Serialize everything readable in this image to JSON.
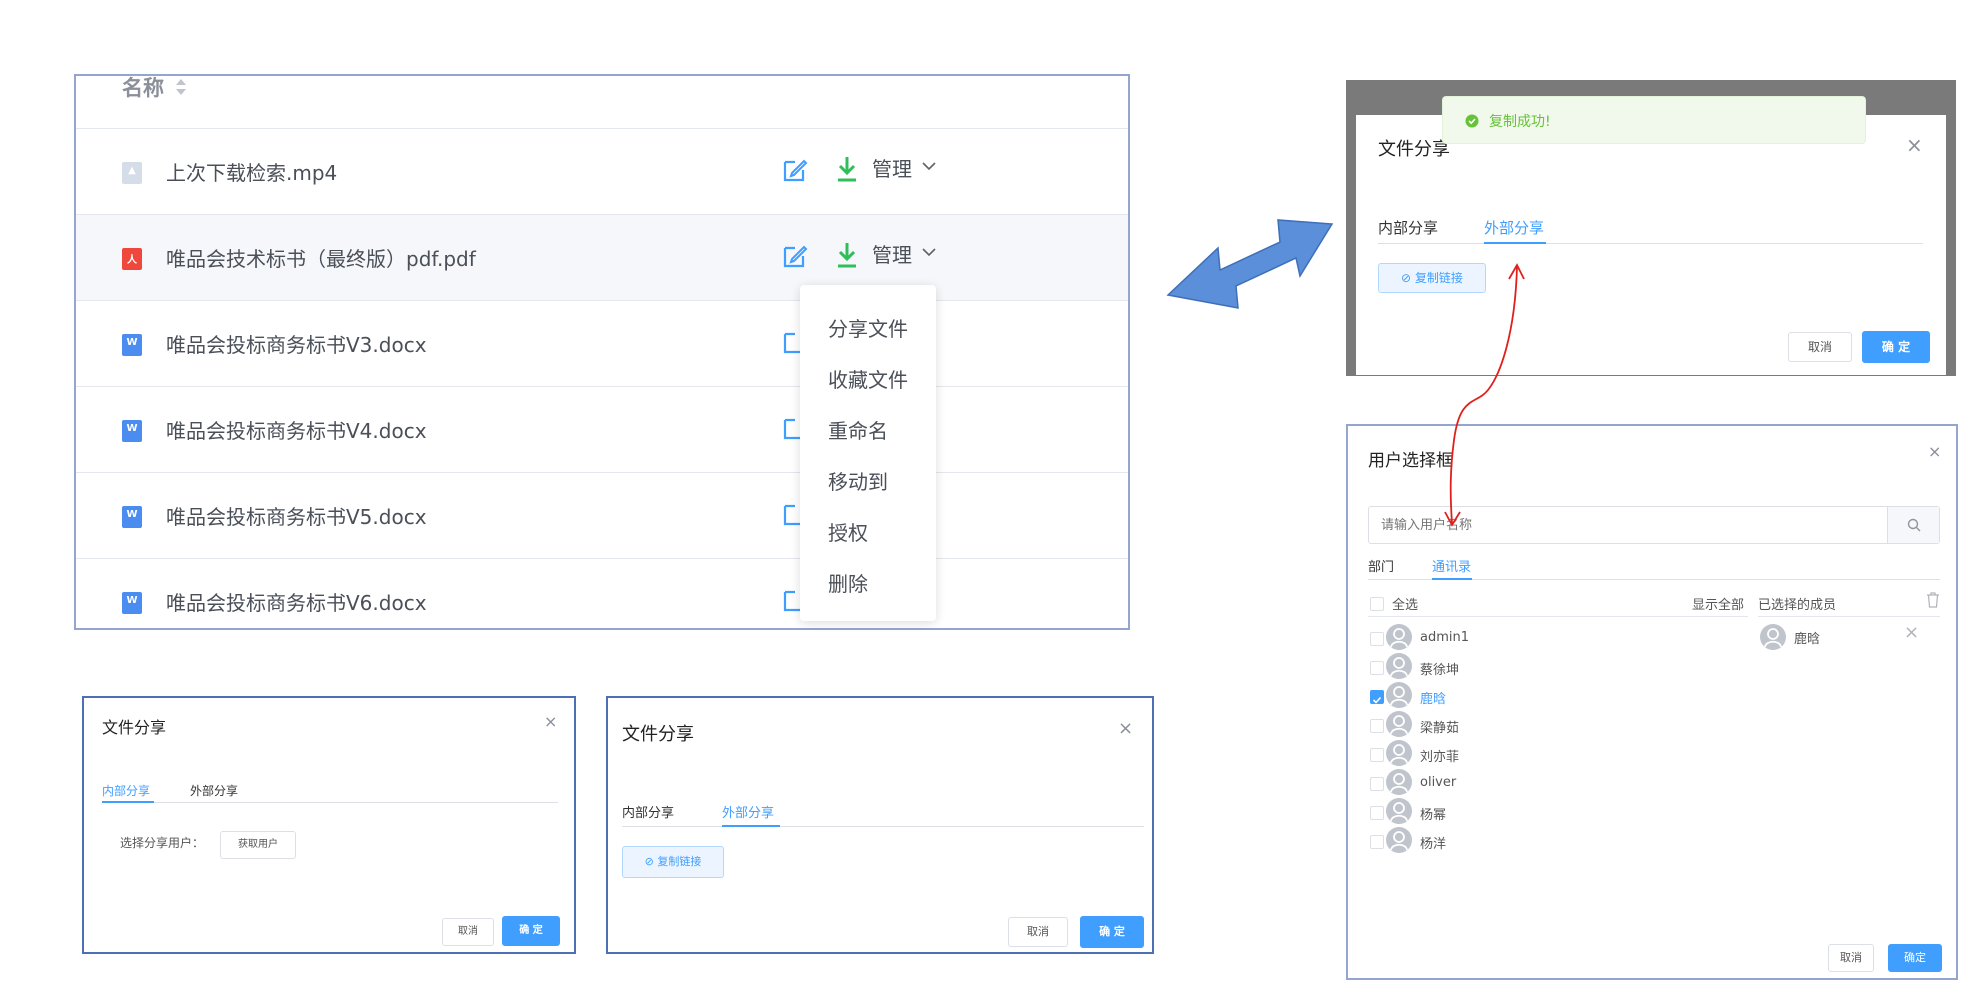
{
  "file_list": {
    "column_header": "名称",
    "rows": [
      {
        "name": "上次下载检索.mp4",
        "type": "video"
      },
      {
        "name": "唯品会技术标书（最终版）pdf.pdf",
        "type": "pdf"
      },
      {
        "name": "唯品会投标商务标书V3.docx",
        "type": "word"
      },
      {
        "name": "唯品会投标商务标书V4.docx",
        "type": "word"
      },
      {
        "name": "唯品会投标商务标书V5.docx",
        "type": "word"
      },
      {
        "name": "唯品会投标商务标书V6.docx",
        "type": "word"
      }
    ],
    "manage_label": "管理",
    "word_icon_letter": "W",
    "pdf_icon_letter": "人"
  },
  "dropdown_menu": [
    "分享文件",
    "收藏文件",
    "重命名",
    "移动到",
    "授权",
    "删除"
  ],
  "share_dialog": {
    "title": "文件分享",
    "tab_internal": "内部分享",
    "tab_external": "外部分享",
    "copy_link": "复制链接",
    "select_user_label": "选择分享用户：",
    "get_user": "获取用户",
    "cancel": "取消",
    "confirm": "确 定",
    "close": "×"
  },
  "toast": {
    "message": "复制成功!",
    "color": "#67c23a"
  },
  "user_dialog": {
    "title": "用户选择框",
    "search_placeholder": "请输入用户名称",
    "tab_department": "部门",
    "tab_contacts": "通讯录",
    "select_all": "全选",
    "show_all": "显示全部",
    "selected_members": "已选择的成员",
    "users": [
      {
        "name": "admin1",
        "checked": false
      },
      {
        "name": "蔡徐坤",
        "checked": false
      },
      {
        "name": "鹿晗",
        "checked": true
      },
      {
        "name": "梁静茹",
        "checked": false
      },
      {
        "name": "刘亦菲",
        "checked": false
      },
      {
        "name": "oliver",
        "checked": false
      },
      {
        "name": "杨幂",
        "checked": false
      },
      {
        "name": "杨洋",
        "checked": false
      }
    ],
    "selected": [
      "鹿晗"
    ],
    "cancel": "取消",
    "confirm": "确定",
    "close": "×"
  },
  "colors": {
    "primary": "#409eff",
    "success": "#67c23a",
    "pdf": "#f0473c",
    "word": "#4a8cf0",
    "arrow_blue": "#5b8fd9",
    "arrow_red": "#e0201a"
  }
}
